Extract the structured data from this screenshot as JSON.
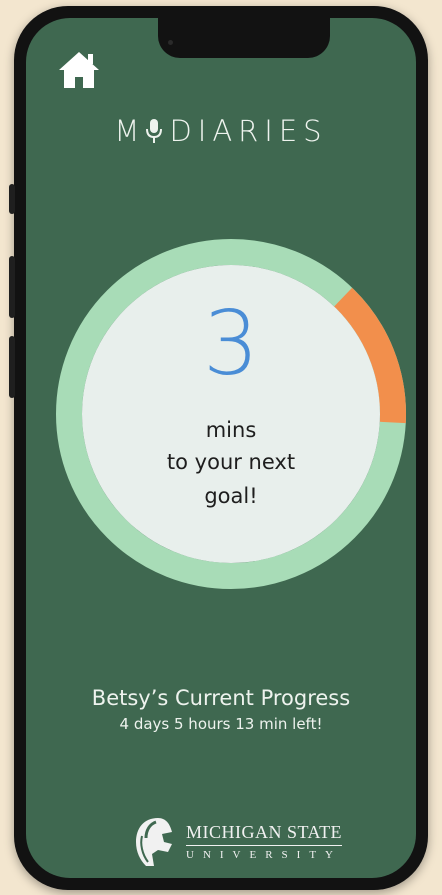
{
  "app": {
    "title": "M DIARIES",
    "title_prefix": "M",
    "title_suffix": "DIARIES"
  },
  "nav": {
    "home_icon": "home-icon"
  },
  "goal": {
    "remaining_value": "3",
    "unit_label": "mins",
    "line2": "to your next",
    "line3": "goal!",
    "progress_fraction": 0.93,
    "ring_color": "#a8dcb7",
    "accent_color": "#f28f4c",
    "inner_color": "#e8efec",
    "number_color": "#4a8dd6"
  },
  "progress": {
    "title": "Betsy’s Current Progress",
    "time_left": "4 days 5 hours 13 min left!"
  },
  "footer": {
    "logo_icon": "spartan-helmet-icon",
    "org_name": "MICHIGAN STATE",
    "org_sub": "UNIVERSITY"
  },
  "colors": {
    "screen_bg": "#3f6850",
    "text_light": "#eef3ee",
    "page_bg": "#f3e6cf"
  }
}
